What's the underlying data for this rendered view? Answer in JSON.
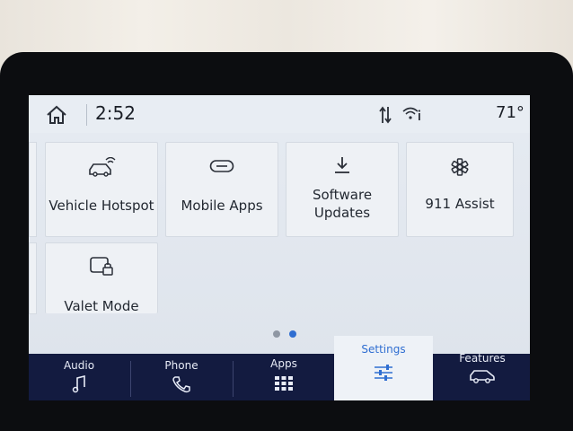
{
  "status": {
    "time": "2:52",
    "temperature": "71°"
  },
  "tiles": [
    {
      "label": "Vehicle Hotspot",
      "icon": "car-wifi-icon"
    },
    {
      "label": "Mobile Apps",
      "icon": "link-icon"
    },
    {
      "label": "Software\nUpdates",
      "icon": "download-icon"
    },
    {
      "label": "911 Assist",
      "icon": "emergency-star-icon"
    },
    {
      "label": "Valet Mode",
      "icon": "car-lock-icon"
    }
  ],
  "pagination": {
    "pages": 2,
    "current": 2
  },
  "nav": [
    {
      "label": "Audio",
      "icon": "music-note-icon"
    },
    {
      "label": "Phone",
      "icon": "phone-icon"
    },
    {
      "label": "Apps",
      "icon": "apps-grid-icon"
    },
    {
      "label": "Settings",
      "icon": "sliders-icon",
      "active": true
    },
    {
      "label": "Features",
      "icon": "suv-icon"
    }
  ],
  "colors": {
    "nav_bg": "#131b40",
    "accent": "#2f6ed1",
    "screen_bg": "#e6ebf2"
  }
}
